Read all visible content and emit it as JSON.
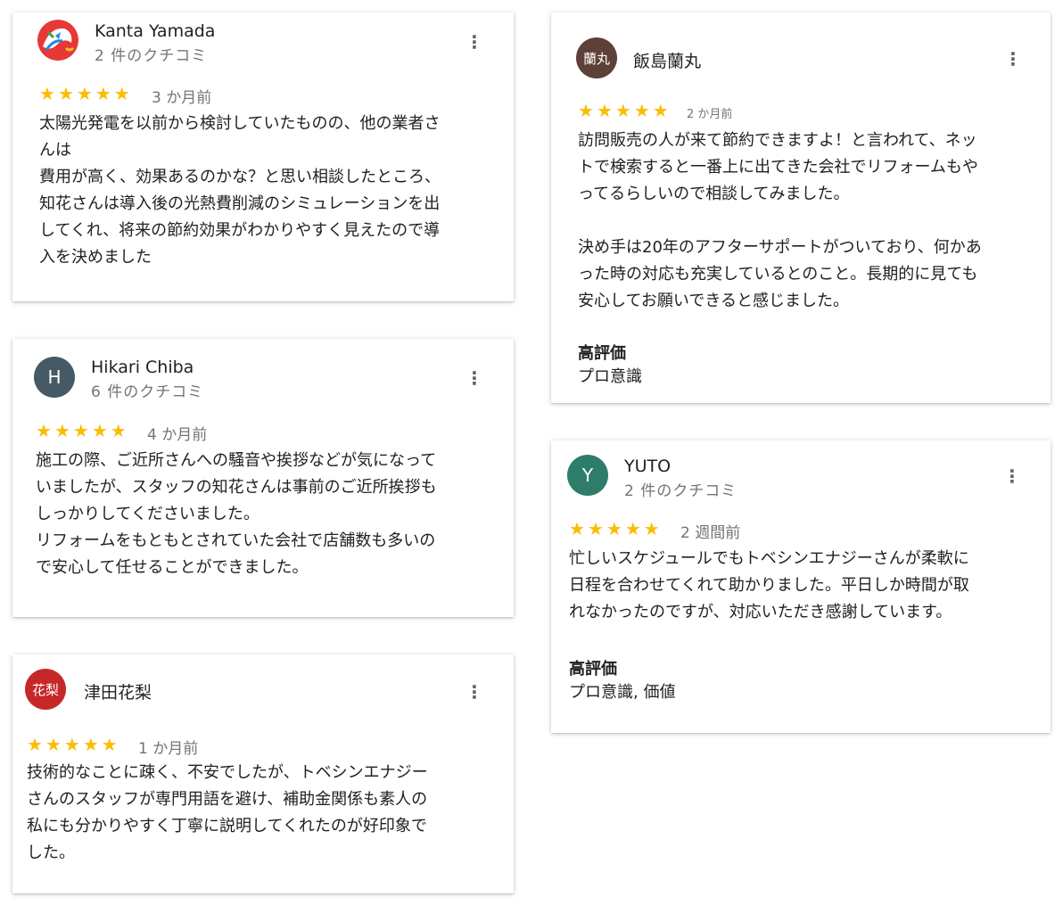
{
  "reviews": [
    {
      "name": "Kanta Yamada",
      "count": "2 件のクチコミ",
      "date": "3 か月前",
      "avatar_colors": [
        "#e53935",
        "#1e88e5",
        "#43a047",
        "#fbc02d"
      ],
      "body": "太陽光発電を以前から検討していたものの、他の業者さ\nんは\n費用が高く、効果あるのかな？と思い相談したところ、\n知花さんは導入後の光熱費削減のシミュレーションを出\nしてくれ、将来の節約効果がわかりやすく見えたので導\n入を決めました"
    },
    {
      "name": "Hikari Chiba",
      "count": "6 件のクチコミ",
      "date": "4 か月前",
      "avatar_text": "H",
      "avatar_color": "#455a64",
      "body": "施工の際、ご近所さんへの騒音や挨拶などが気になって\nいましたが、スタッフの知花さんは事前のご近所挨拶も\nしっかりしてくださいました。\nリフォームをもともとされていた会社で店舗数も多いの\nで安心して任せることができました。"
    },
    {
      "name": "津田花梨",
      "date": "1 か月前",
      "avatar_text": "花梨",
      "avatar_color": "#c62828",
      "body": "技術的なことに疎く、不安でしたが、トベシンエナジー\nさんのスタッフが専門用語を避け、補助金関係も素人の\n私にも分かりやすく丁寧に説明してくれたのが好印象で\nした。"
    },
    {
      "name": "飯島蘭丸",
      "date": "2 か月前",
      "avatar_text": "蘭丸",
      "avatar_color": "#5d4037",
      "body": "訪問販売の人が来て節約できますよ！と言われて、ネッ\nトで検索すると一番上に出てきた会社でリフォームもや\nってるらしいので相談してみました。\n\n決め手は20年のアフターサポートがついており、何かあ\nった時の対応も充実しているとのこと。長期的に見ても\n安心してお願いできると感じました。",
      "highlights_title": "高評価",
      "highlights": "プロ意識"
    },
    {
      "name": "YUTO",
      "count": "2 件のクチコミ",
      "date": "2 週間前",
      "avatar_text": "Y",
      "avatar_color": "#2e7d6a",
      "body": "忙しいスケジュールでもトベシンエナジーさんが柔軟に\n日程を合わせてくれて助かりました。平日しか時間が取\nれなかったのですが、対応いただき感謝しています。",
      "highlights_title": "高評価",
      "highlights": "プロ意識, 価値"
    }
  ],
  "menu_icon": "more-vert-icon",
  "star_icon": "star-icon",
  "star_glyph": "★",
  "menu_glyph": "⋮",
  "star_color": "#fbbc04"
}
